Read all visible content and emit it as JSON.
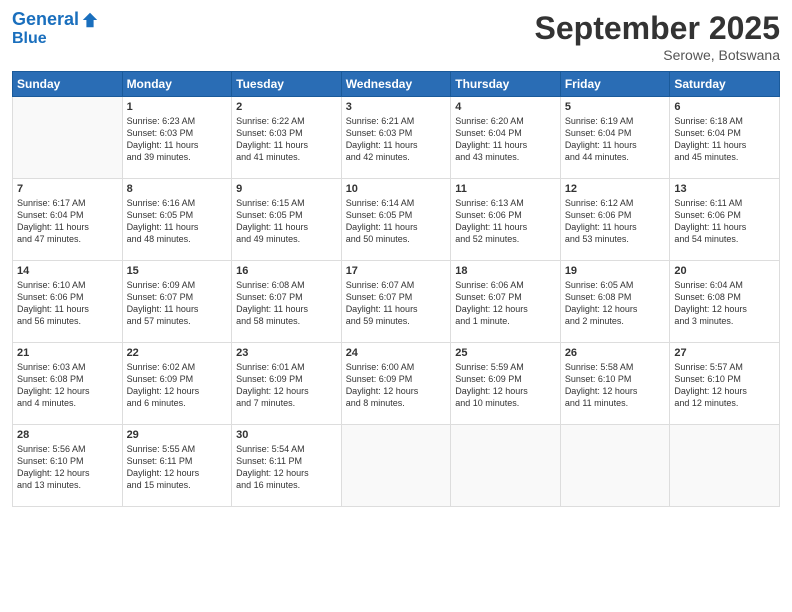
{
  "header": {
    "logo_line1": "General",
    "logo_line2": "Blue",
    "month": "September 2025",
    "location": "Serowe, Botswana"
  },
  "weekdays": [
    "Sunday",
    "Monday",
    "Tuesday",
    "Wednesday",
    "Thursday",
    "Friday",
    "Saturday"
  ],
  "weeks": [
    [
      {
        "day": "",
        "info": ""
      },
      {
        "day": "1",
        "info": "Sunrise: 6:23 AM\nSunset: 6:03 PM\nDaylight: 11 hours\nand 39 minutes."
      },
      {
        "day": "2",
        "info": "Sunrise: 6:22 AM\nSunset: 6:03 PM\nDaylight: 11 hours\nand 41 minutes."
      },
      {
        "day": "3",
        "info": "Sunrise: 6:21 AM\nSunset: 6:03 PM\nDaylight: 11 hours\nand 42 minutes."
      },
      {
        "day": "4",
        "info": "Sunrise: 6:20 AM\nSunset: 6:04 PM\nDaylight: 11 hours\nand 43 minutes."
      },
      {
        "day": "5",
        "info": "Sunrise: 6:19 AM\nSunset: 6:04 PM\nDaylight: 11 hours\nand 44 minutes."
      },
      {
        "day": "6",
        "info": "Sunrise: 6:18 AM\nSunset: 6:04 PM\nDaylight: 11 hours\nand 45 minutes."
      }
    ],
    [
      {
        "day": "7",
        "info": "Sunrise: 6:17 AM\nSunset: 6:04 PM\nDaylight: 11 hours\nand 47 minutes."
      },
      {
        "day": "8",
        "info": "Sunrise: 6:16 AM\nSunset: 6:05 PM\nDaylight: 11 hours\nand 48 minutes."
      },
      {
        "day": "9",
        "info": "Sunrise: 6:15 AM\nSunset: 6:05 PM\nDaylight: 11 hours\nand 49 minutes."
      },
      {
        "day": "10",
        "info": "Sunrise: 6:14 AM\nSunset: 6:05 PM\nDaylight: 11 hours\nand 50 minutes."
      },
      {
        "day": "11",
        "info": "Sunrise: 6:13 AM\nSunset: 6:06 PM\nDaylight: 11 hours\nand 52 minutes."
      },
      {
        "day": "12",
        "info": "Sunrise: 6:12 AM\nSunset: 6:06 PM\nDaylight: 11 hours\nand 53 minutes."
      },
      {
        "day": "13",
        "info": "Sunrise: 6:11 AM\nSunset: 6:06 PM\nDaylight: 11 hours\nand 54 minutes."
      }
    ],
    [
      {
        "day": "14",
        "info": "Sunrise: 6:10 AM\nSunset: 6:06 PM\nDaylight: 11 hours\nand 56 minutes."
      },
      {
        "day": "15",
        "info": "Sunrise: 6:09 AM\nSunset: 6:07 PM\nDaylight: 11 hours\nand 57 minutes."
      },
      {
        "day": "16",
        "info": "Sunrise: 6:08 AM\nSunset: 6:07 PM\nDaylight: 11 hours\nand 58 minutes."
      },
      {
        "day": "17",
        "info": "Sunrise: 6:07 AM\nSunset: 6:07 PM\nDaylight: 11 hours\nand 59 minutes."
      },
      {
        "day": "18",
        "info": "Sunrise: 6:06 AM\nSunset: 6:07 PM\nDaylight: 12 hours\nand 1 minute."
      },
      {
        "day": "19",
        "info": "Sunrise: 6:05 AM\nSunset: 6:08 PM\nDaylight: 12 hours\nand 2 minutes."
      },
      {
        "day": "20",
        "info": "Sunrise: 6:04 AM\nSunset: 6:08 PM\nDaylight: 12 hours\nand 3 minutes."
      }
    ],
    [
      {
        "day": "21",
        "info": "Sunrise: 6:03 AM\nSunset: 6:08 PM\nDaylight: 12 hours\nand 4 minutes."
      },
      {
        "day": "22",
        "info": "Sunrise: 6:02 AM\nSunset: 6:09 PM\nDaylight: 12 hours\nand 6 minutes."
      },
      {
        "day": "23",
        "info": "Sunrise: 6:01 AM\nSunset: 6:09 PM\nDaylight: 12 hours\nand 7 minutes."
      },
      {
        "day": "24",
        "info": "Sunrise: 6:00 AM\nSunset: 6:09 PM\nDaylight: 12 hours\nand 8 minutes."
      },
      {
        "day": "25",
        "info": "Sunrise: 5:59 AM\nSunset: 6:09 PM\nDaylight: 12 hours\nand 10 minutes."
      },
      {
        "day": "26",
        "info": "Sunrise: 5:58 AM\nSunset: 6:10 PM\nDaylight: 12 hours\nand 11 minutes."
      },
      {
        "day": "27",
        "info": "Sunrise: 5:57 AM\nSunset: 6:10 PM\nDaylight: 12 hours\nand 12 minutes."
      }
    ],
    [
      {
        "day": "28",
        "info": "Sunrise: 5:56 AM\nSunset: 6:10 PM\nDaylight: 12 hours\nand 13 minutes."
      },
      {
        "day": "29",
        "info": "Sunrise: 5:55 AM\nSunset: 6:11 PM\nDaylight: 12 hours\nand 15 minutes."
      },
      {
        "day": "30",
        "info": "Sunrise: 5:54 AM\nSunset: 6:11 PM\nDaylight: 12 hours\nand 16 minutes."
      },
      {
        "day": "",
        "info": ""
      },
      {
        "day": "",
        "info": ""
      },
      {
        "day": "",
        "info": ""
      },
      {
        "day": "",
        "info": ""
      }
    ]
  ]
}
